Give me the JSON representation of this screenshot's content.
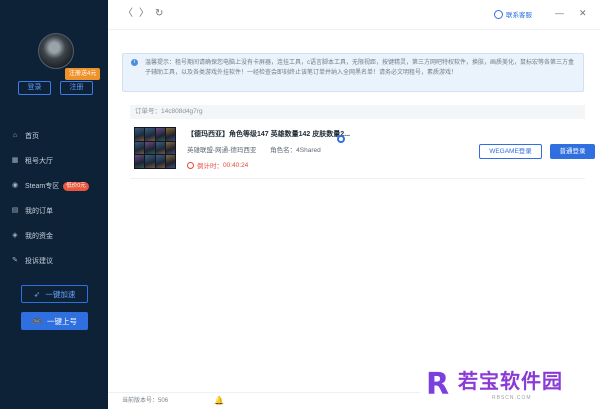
{
  "sidebar": {
    "register_badge": "注册送4元",
    "login_label": "登录",
    "register_label": "注册",
    "nav": [
      {
        "label": "首页",
        "icon": "home-icon"
      },
      {
        "label": "租号大厅",
        "icon": "grid-icon"
      },
      {
        "label": "Steam专区",
        "icon": "steam-icon",
        "badge": "低价0元"
      },
      {
        "label": "我的订单",
        "icon": "order-icon"
      },
      {
        "label": "我的资金",
        "icon": "wallet-icon"
      },
      {
        "label": "投诉建议",
        "icon": "feedback-icon"
      }
    ],
    "quick_speed_label": "一键加速",
    "quick_login_label": "一键上号"
  },
  "titlebar": {
    "service_label": "联系客服"
  },
  "notice": {
    "text": "温馨提示：租号期间请确保您电脑上没有卡屏器，连挂工具，c语言脚本工具，无限视距，按键精灵，第三方网吧特权软件，换肤，画质美化，鼠标宏等各第三方盒子辅助工具，以及各类游戏外挂软件！一经检查会即刻终止该笔订单并纳入全网黑名单！请务必文明租号，素质游戏！"
  },
  "order": {
    "order_no_label": "订单号：",
    "order_no": "14c808d4g7rg",
    "title": "【德玛西亚】角色等级147 英雄数量142 皮肤数量2...",
    "region": "英雄联盟-网通-德玛西亚",
    "role_label": "角色名：",
    "role_name": "4Shared",
    "countdown_label": "倒计时：",
    "countdown": "00:40:24",
    "wegame_login_label": "WEGAME登录",
    "normal_login_label": "普通登录"
  },
  "footer": {
    "version_label": "当前版本号：",
    "version": "506"
  },
  "watermark": {
    "logo_letter": "R",
    "name": "若宝软件园",
    "url": "RBSCN.COM"
  },
  "colors": {
    "sidebar_bg": "#0d2237",
    "accent": "#2f6fe0",
    "countdown": "#e04c3c",
    "badge_orange": "#f0922a",
    "badge_red": "#e9573f"
  }
}
